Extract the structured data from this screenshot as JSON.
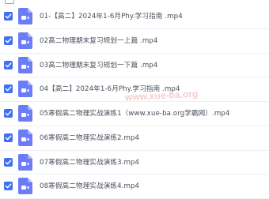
{
  "colors": {
    "checkbox": "#3f6ff5",
    "video_icon": "#6b7cf7",
    "watermark": "#dc6e6e"
  },
  "files": [
    {
      "name": "01-【高二】2024年1-6月Phy.学习指南 .mp4",
      "checked": true,
      "icon": "video-file-icon"
    },
    {
      "name": "02高二物理期末复习规划一上篇 .mp4",
      "checked": true,
      "icon": "video-file-icon"
    },
    {
      "name": "03高二物理期末复习规划一下篇 .mp4",
      "checked": true,
      "icon": "video-file-icon"
    },
    {
      "name": "04【高二】2024年1-6月Phy.学习指南 .mp4",
      "checked": true,
      "icon": "video-file-icon"
    },
    {
      "name": "05寒假高二物理实战演练1（www.xue-ba.org学霸网）.mp4",
      "checked": true,
      "icon": "video-file-icon"
    },
    {
      "name": "06寒假高二物理实战演练2.mp4",
      "checked": true,
      "icon": "video-file-icon"
    },
    {
      "name": "07寒假高二物理实战演练3.mp4",
      "checked": true,
      "icon": "video-file-icon"
    },
    {
      "name": "08寒假高二物理实战演练4.mp4",
      "checked": true,
      "icon": "video-file-icon"
    }
  ],
  "watermark": "www.xue-ba.org"
}
